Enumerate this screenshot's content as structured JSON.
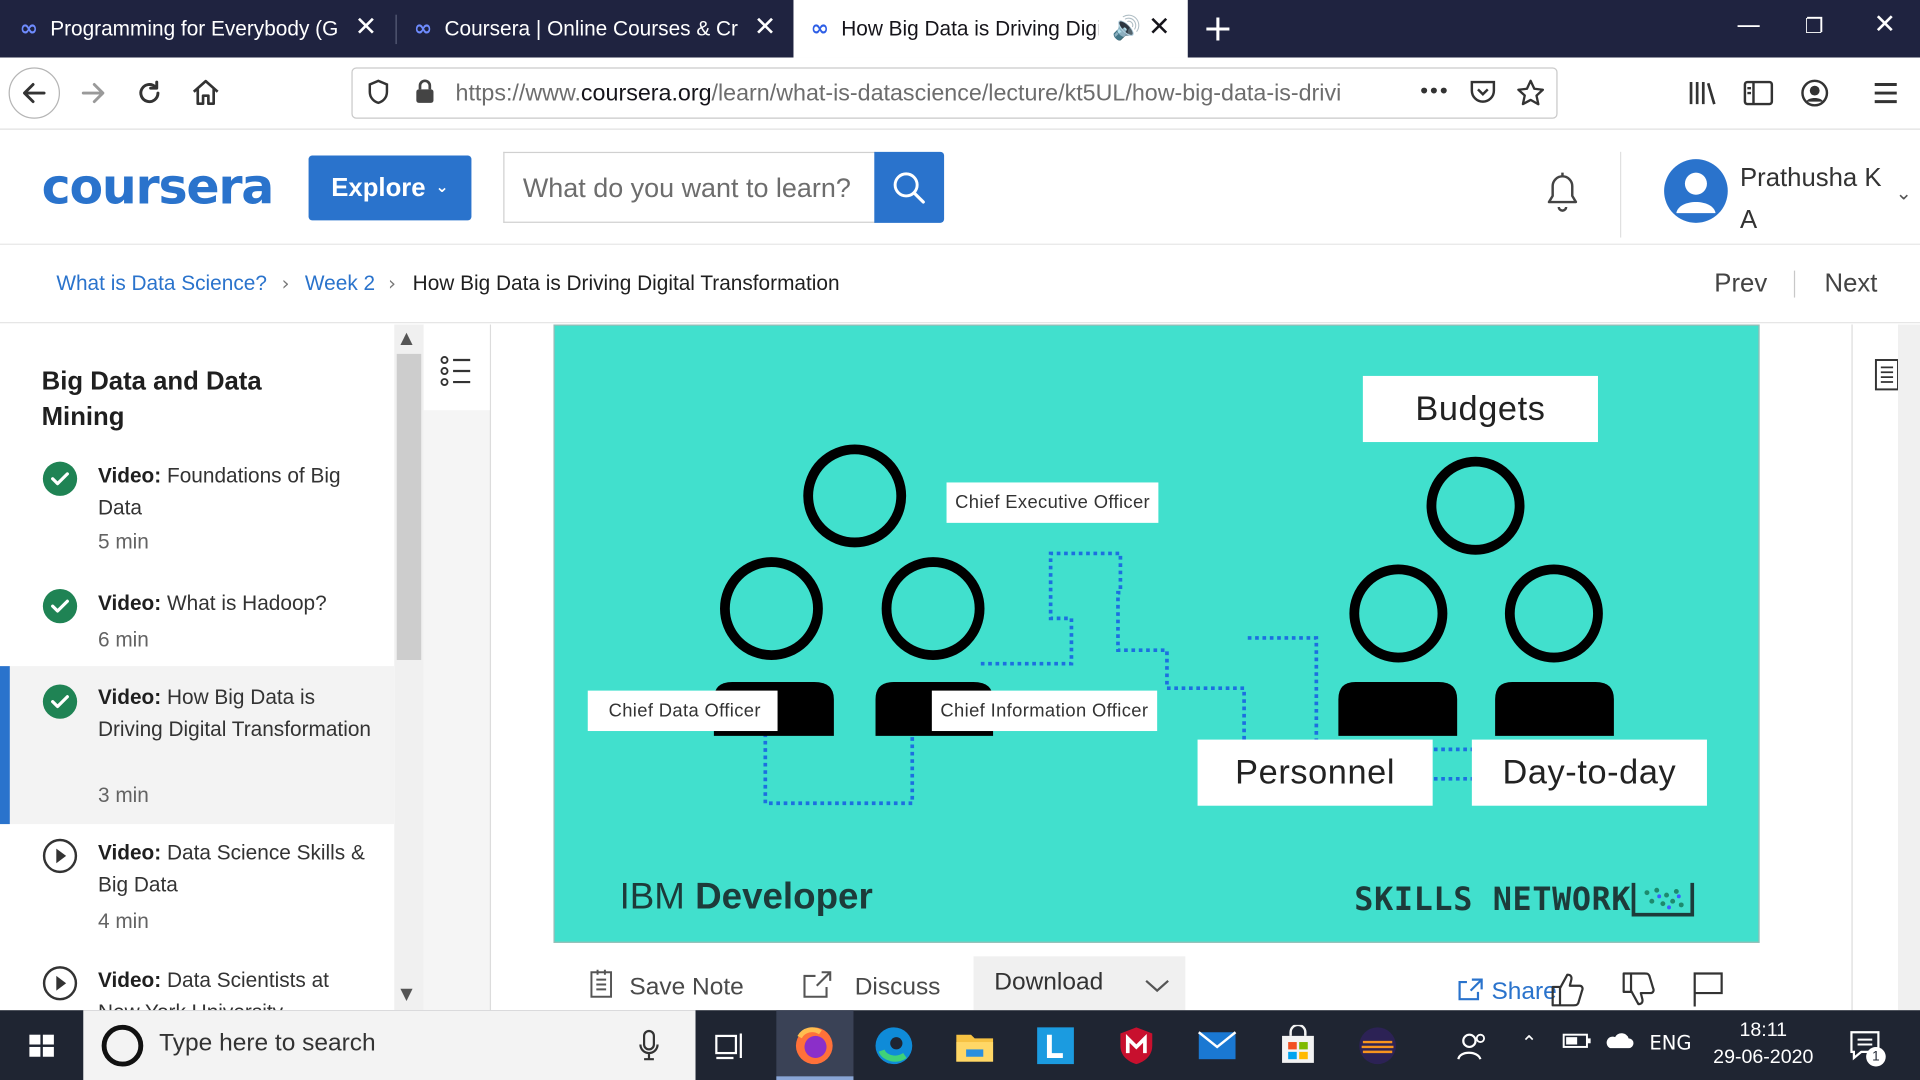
{
  "browser": {
    "tabs": [
      {
        "title": "Programming for Everybody (G"
      },
      {
        "title": "Coursera | Online Courses & Cr"
      },
      {
        "title": "How Big Data is Driving Digi"
      }
    ],
    "url_prefix": "https://www.",
    "url_domain": "coursera.org",
    "url_path": "/learn/what-is-datascience/lecture/kt5UL/how-big-data-is-drivi",
    "more_glyph": "•••"
  },
  "header": {
    "logo": "coursera",
    "explore_label": "Explore",
    "search_placeholder": "What do you want to learn?",
    "user_name": "Prathusha K A"
  },
  "breadcrumb": {
    "items": [
      "What is Data Science?",
      "Week 2",
      "How Big Data is Driving Digital Transformation"
    ],
    "prev": "Prev",
    "next": "Next"
  },
  "sidebar": {
    "section_title": "Big Data and Data Mining",
    "items": [
      {
        "kind": "Video:",
        "title": "Foundations of Big Data",
        "duration": "5 min",
        "status": "done"
      },
      {
        "kind": "Video:",
        "title": "What is Hadoop?",
        "duration": "6 min",
        "status": "done"
      },
      {
        "kind": "Video:",
        "title": "How Big Data is Driving Digital Transformation",
        "duration": "3 min",
        "status": "done"
      },
      {
        "kind": "Video:",
        "title": "Data Science Skills & Big Data",
        "duration": "4 min",
        "status": "todo"
      },
      {
        "kind": "Video:",
        "title": "Data Scientists at New York University",
        "duration": "",
        "status": "todo"
      }
    ]
  },
  "video": {
    "labels": {
      "ceo": "Chief Executive Officer",
      "cdo": "Chief Data Officer",
      "cio": "Chief Information Officer",
      "budgets": "Budgets",
      "personnel": "Personnel",
      "daytoday": "Day-to-day"
    },
    "brand_left_a": "IBM ",
    "brand_left_b": "Developer",
    "brand_right": "SKILLS NETWORK"
  },
  "toolbar": {
    "save_note": "Save Note",
    "discuss": "Discuss",
    "download": "Download",
    "share": "Share"
  },
  "taskbar": {
    "search_placeholder": "Type here to search",
    "language": "ENG",
    "time": "18:11",
    "date": "29-06-2020",
    "notification_count": "1"
  },
  "colors": {
    "brand_blue": "#2a73cc",
    "video_bg": "#41e0cd",
    "done_green": "#1f8354",
    "tab_strip": "#1f2340"
  }
}
